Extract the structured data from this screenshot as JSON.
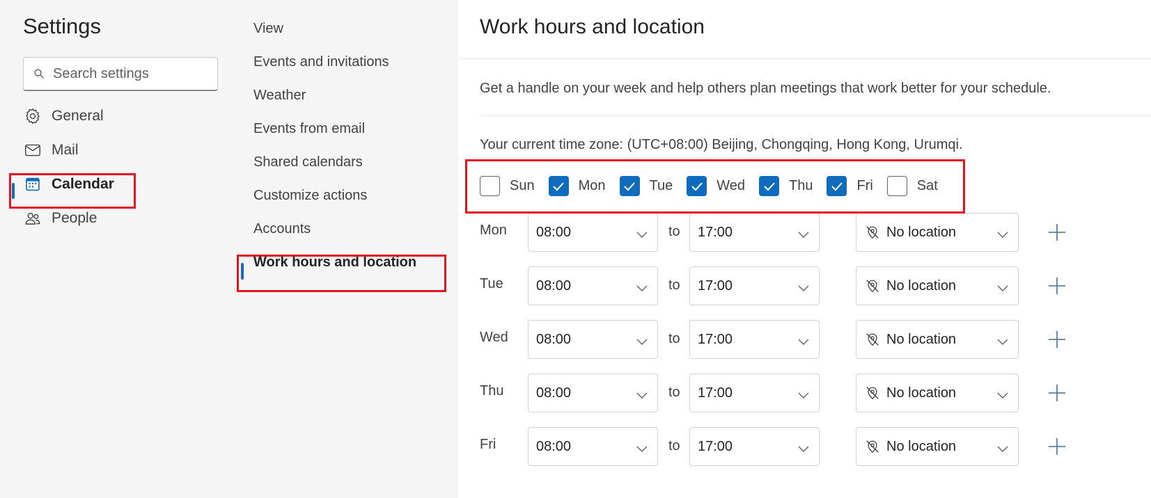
{
  "settings": {
    "title": "Settings",
    "search_placeholder": "Search settings",
    "nav": [
      {
        "label": "General",
        "icon": "gear-icon"
      },
      {
        "label": "Mail",
        "icon": "mail-icon"
      },
      {
        "label": "Calendar",
        "icon": "calendar-icon",
        "selected": true
      },
      {
        "label": "People",
        "icon": "people-icon"
      }
    ]
  },
  "calendar_menu": [
    {
      "label": "View"
    },
    {
      "label": "Events and invitations"
    },
    {
      "label": "Weather"
    },
    {
      "label": "Events from email"
    },
    {
      "label": "Shared calendars"
    },
    {
      "label": "Customize actions"
    },
    {
      "label": "Accounts"
    },
    {
      "label": "Work hours and location",
      "selected": true
    }
  ],
  "page": {
    "title": "Work hours and location",
    "description": "Get a handle on your week and help others plan meetings that work better for your schedule.",
    "timezone": "Your current time zone: (UTC+08:00) Beijing, Chongqing, Hong Kong, Urumqi."
  },
  "workdays": [
    {
      "label": "Sun",
      "checked": false
    },
    {
      "label": "Mon",
      "checked": true
    },
    {
      "label": "Tue",
      "checked": true
    },
    {
      "label": "Wed",
      "checked": true
    },
    {
      "label": "Thu",
      "checked": true
    },
    {
      "label": "Fri",
      "checked": true
    },
    {
      "label": "Sat",
      "checked": false
    }
  ],
  "to_label": "to",
  "schedule": [
    {
      "day": "Mon",
      "start": "08:00",
      "end": "17:00",
      "location": "No location"
    },
    {
      "day": "Tue",
      "start": "08:00",
      "end": "17:00",
      "location": "No location"
    },
    {
      "day": "Wed",
      "start": "08:00",
      "end": "17:00",
      "location": "No location"
    },
    {
      "day": "Thu",
      "start": "08:00",
      "end": "17:00",
      "location": "No location"
    },
    {
      "day": "Fri",
      "start": "08:00",
      "end": "17:00",
      "location": "No location"
    }
  ],
  "colors": {
    "accent": "#0f6cbd",
    "highlight_box": "#e0141e",
    "pane_background": "#f5f5f5"
  }
}
